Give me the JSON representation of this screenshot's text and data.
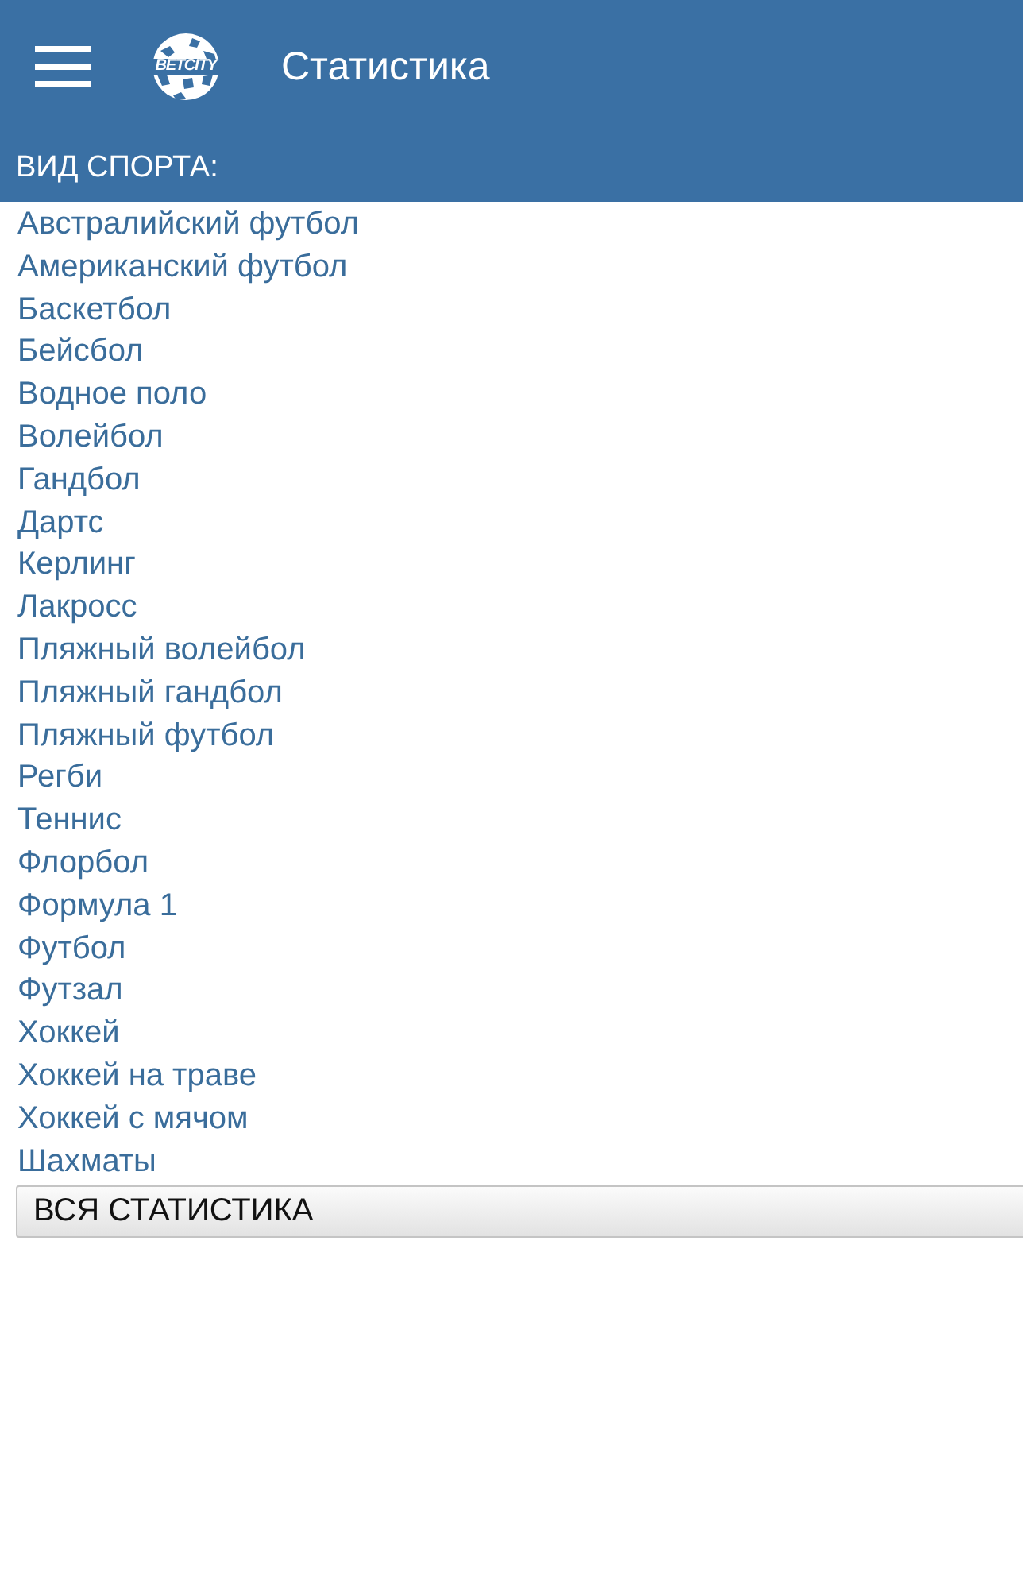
{
  "app_bar": {
    "logo_text": "BETCITY",
    "title": "Статистика"
  },
  "sport_section": {
    "heading": "ВИД СПОРТА:",
    "items": [
      "Австралийский футбол",
      "Американский футбол",
      "Баскетбол",
      "Бейсбол",
      "Водное поло",
      "Волейбол",
      "Гандбол",
      "Дартс",
      "Керлинг",
      "Лакросс",
      "Пляжный волейбол",
      "Пляжный гандбол",
      "Пляжный футбол",
      "Регби",
      "Теннис",
      "Флорбол",
      "Формула 1",
      "Футбол",
      "Футзал",
      "Хоккей",
      "Хоккей на траве",
      "Хоккей с мячом",
      "Шахматы"
    ]
  },
  "all_stats_button": {
    "label": "ВСЯ СТАТИСТИКА"
  }
}
